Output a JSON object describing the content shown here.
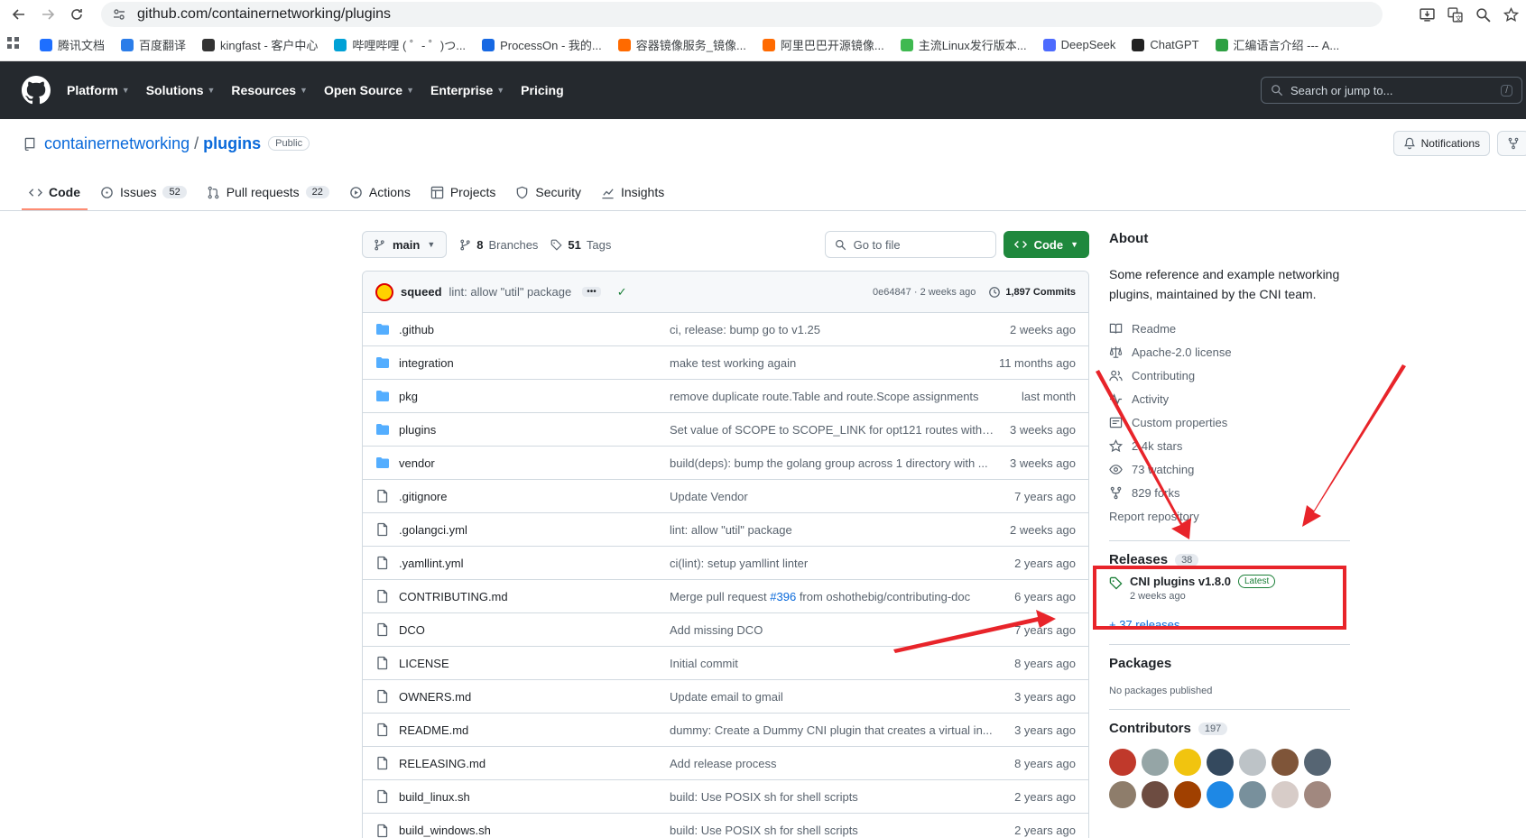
{
  "browser": {
    "url": "github.com/containernetworking/plugins",
    "bookmarks": [
      {
        "label": "腾讯文档",
        "color": "#1e6fff"
      },
      {
        "label": "百度翻译",
        "color": "#2b7de9"
      },
      {
        "label": "kingfast - 客户中心",
        "color": "#333333"
      },
      {
        "label": "哔哩哔哩 ( ゜- ゜)つ...",
        "color": "#00a1d6"
      },
      {
        "label": "ProcessOn - 我的...",
        "color": "#1668e3"
      },
      {
        "label": "容器镜像服务_镜像...",
        "color": "#ff6a00"
      },
      {
        "label": "阿里巴巴开源镜像...",
        "color": "#ff6a00"
      },
      {
        "label": "主流Linux发行版本...",
        "color": "#3fb950"
      },
      {
        "label": "DeepSeek",
        "color": "#4d6bfe"
      },
      {
        "label": "ChatGPT",
        "color": "#222222"
      },
      {
        "label": "汇编语言介绍 --- A...",
        "color": "#2ea043"
      }
    ]
  },
  "header": {
    "nav": [
      "Platform",
      "Solutions",
      "Resources",
      "Open Source",
      "Enterprise",
      "Pricing"
    ],
    "search_placeholder": "Search or jump to...",
    "search_shortcut": "/"
  },
  "repo": {
    "owner": "containernetworking",
    "name": "plugins",
    "visibility": "Public",
    "notifications_label": "Notifications",
    "tabs": [
      {
        "label": "Code",
        "count": ""
      },
      {
        "label": "Issues",
        "count": "52"
      },
      {
        "label": "Pull requests",
        "count": "22"
      },
      {
        "label": "Actions",
        "count": ""
      },
      {
        "label": "Projects",
        "count": ""
      },
      {
        "label": "Security",
        "count": ""
      },
      {
        "label": "Insights",
        "count": ""
      }
    ]
  },
  "filenav": {
    "branch": "main",
    "branches_count": "8",
    "branches_label": "Branches",
    "tags_count": "51",
    "tags_label": "Tags",
    "goto_placeholder": "Go to file",
    "code_label": "Code"
  },
  "commit": {
    "author": "squeed",
    "message": "lint: allow \"util\" package",
    "sha_time": "0e64847 · 2 weeks ago",
    "count": "1,897 Commits"
  },
  "files": [
    {
      "name": ".github",
      "type": "dir",
      "msg": "ci, release: bump go to v1.25",
      "date": "2 weeks ago"
    },
    {
      "name": "integration",
      "type": "dir",
      "msg": "make test working again",
      "date": "11 months ago"
    },
    {
      "name": "pkg",
      "type": "dir",
      "msg": "remove duplicate route.Table and route.Scope assignments",
      "date": "last month"
    },
    {
      "name": "plugins",
      "type": "dir",
      "msg": "Set value of SCOPE to SCOPE_LINK for opt121 routes with ro...",
      "date": "3 weeks ago"
    },
    {
      "name": "vendor",
      "type": "dir",
      "msg": "build(deps): bump the golang group across 1 directory with ...",
      "date": "3 weeks ago"
    },
    {
      "name": ".gitignore",
      "type": "file",
      "msg": "Update Vendor",
      "date": "7 years ago"
    },
    {
      "name": ".golangci.yml",
      "type": "file",
      "msg": "lint: allow \"util\" package",
      "date": "2 weeks ago"
    },
    {
      "name": ".yamllint.yml",
      "type": "file",
      "msg": "ci(lint): setup yamllint linter",
      "date": "2 years ago"
    },
    {
      "name": "CONTRIBUTING.md",
      "type": "file",
      "msg": "Merge pull request ",
      "link": "#396",
      "msg_after": " from oshothebig/contributing-doc",
      "date": "6 years ago"
    },
    {
      "name": "DCO",
      "type": "file",
      "msg": "Add missing DCO",
      "date": "7 years ago"
    },
    {
      "name": "LICENSE",
      "type": "file",
      "msg": "Initial commit",
      "date": "8 years ago"
    },
    {
      "name": "OWNERS.md",
      "type": "file",
      "msg": "Update email to gmail",
      "date": "3 years ago"
    },
    {
      "name": "README.md",
      "type": "file",
      "msg": "dummy: Create a Dummy CNI plugin that creates a virtual in...",
      "date": "3 years ago"
    },
    {
      "name": "RELEASING.md",
      "type": "file",
      "msg": "Add release process",
      "date": "8 years ago"
    },
    {
      "name": "build_linux.sh",
      "type": "file",
      "msg": "build: Use POSIX sh for shell scripts",
      "date": "2 years ago"
    },
    {
      "name": "build_windows.sh",
      "type": "file",
      "msg": "build: Use POSIX sh for shell scripts",
      "date": "2 years ago"
    }
  ],
  "about": {
    "title": "About",
    "description": "Some reference and example networking plugins, maintained by the CNI team.",
    "links": [
      {
        "icon": "book-icon",
        "label": "Readme"
      },
      {
        "icon": "law-icon",
        "label": "Apache-2.0 license"
      },
      {
        "icon": "people-icon",
        "label": "Contributing"
      },
      {
        "icon": "pulse-icon",
        "label": "Activity"
      },
      {
        "icon": "note-icon",
        "label": "Custom properties"
      },
      {
        "icon": "star-icon",
        "label": "2.4k stars"
      },
      {
        "icon": "eye-icon",
        "label": "73 watching"
      },
      {
        "icon": "fork-icon",
        "label": "829 forks"
      }
    ],
    "report": "Report repository"
  },
  "releases": {
    "title": "Releases",
    "count": "38",
    "latest_name": "CNI plugins v1.8.0",
    "latest_badge": "Latest",
    "latest_date": "2 weeks ago",
    "more": "+ 37 releases"
  },
  "packages": {
    "title": "Packages",
    "empty": "No packages published"
  },
  "contributors": {
    "title": "Contributors",
    "count": "197",
    "avatar_colors": [
      "#c0392b",
      "#95a5a6",
      "#f1c40f",
      "#34495e",
      "#bdc3c7",
      "#7f5539",
      "#566573",
      "#8e7d6b",
      "#6d4c41",
      "#a04000",
      "#1e88e5",
      "#78909c",
      "#d7ccc8",
      "#a1887f"
    ]
  },
  "annotation": {
    "color": "#e8242a"
  }
}
